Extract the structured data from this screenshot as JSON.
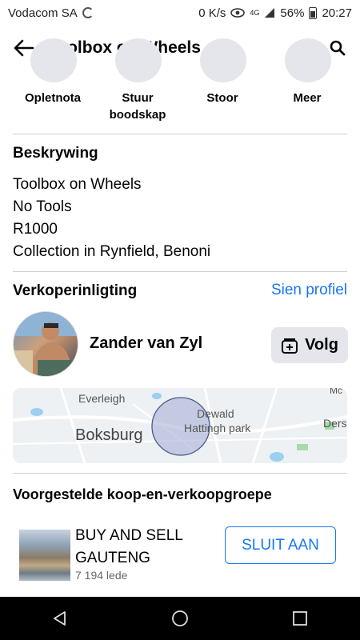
{
  "status_bar": {
    "carrier": "Vodacom SA",
    "speed": "0 K/s",
    "network": "4G",
    "battery": "56%",
    "time": "20:27"
  },
  "header": {
    "title": "Toolbox on Wheels"
  },
  "actions": [
    {
      "label": "Opletnota"
    },
    {
      "label": "Stuur boodskap"
    },
    {
      "label": "Stoor"
    },
    {
      "label": "Meer"
    }
  ],
  "description": {
    "heading": "Beskrywing",
    "lines": [
      "Toolbox on Wheels",
      "No Tools",
      "R1000",
      "Collection in Rynfield, Benoni"
    ]
  },
  "seller": {
    "heading": "Verkoperinligting",
    "profile_link": "Sien profiel",
    "name": "Zander van Zyl",
    "follow_label": "Volg"
  },
  "map": {
    "labels": [
      "Everleigh",
      "Boksburg",
      "Dewald",
      "Hattingh park",
      "Dersl",
      "Mc"
    ]
  },
  "groups": {
    "heading": "Voorgestelde koop-en-verkoopgroepe",
    "items": [
      {
        "name": "BUY AND SELL GAUTENG",
        "members": "7 194 lede",
        "join_label": "SLUIT AAN"
      }
    ]
  },
  "colors": {
    "accent": "#1877f2",
    "button_bg": "#e4e6eb",
    "divider": "#ccd0d5"
  }
}
